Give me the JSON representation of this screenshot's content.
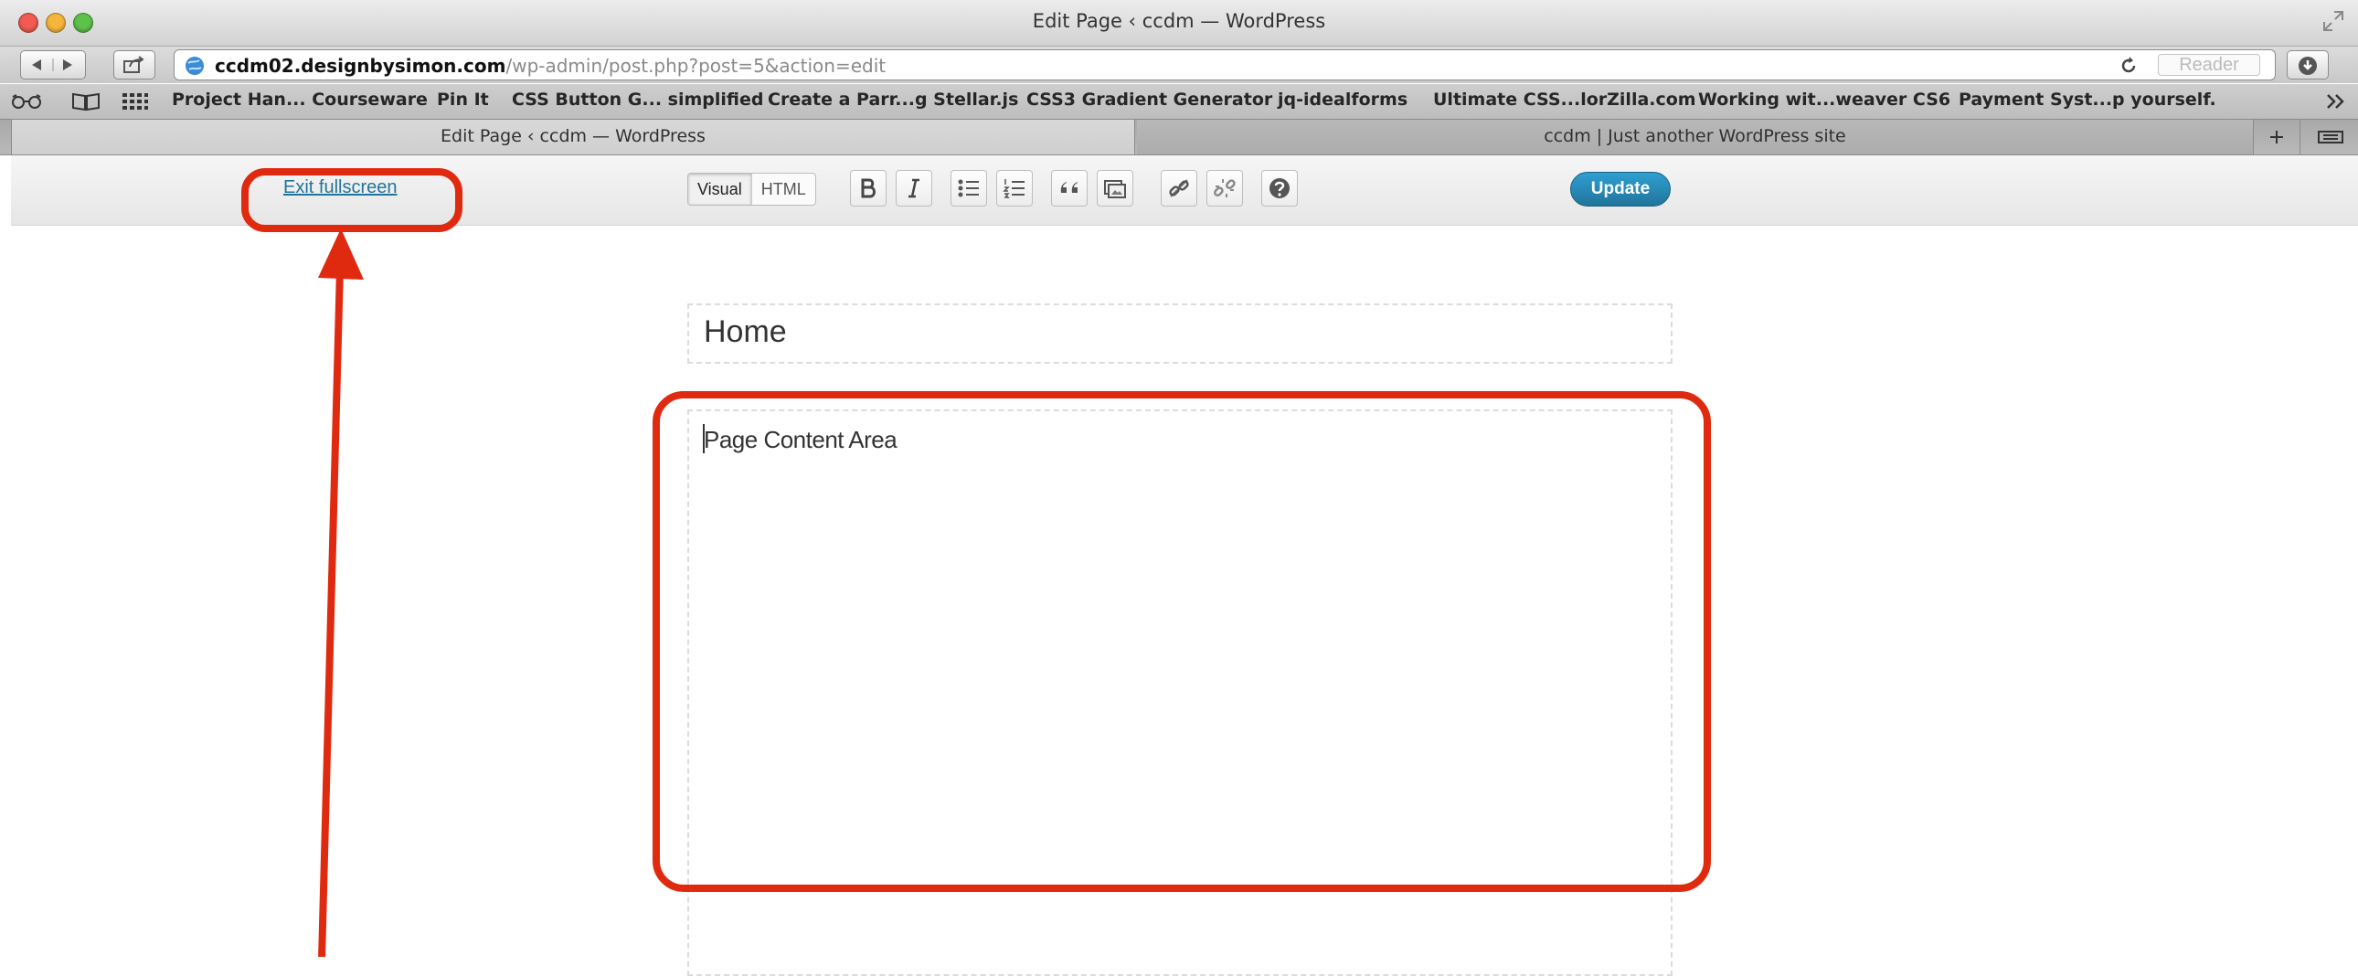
{
  "window": {
    "title": "Edit Page ‹ ccdm — WordPress"
  },
  "toolbar": {
    "url_host": "ccdm02.designbysimon.com",
    "url_path": "/wp-admin/post.php?post=5&action=edit",
    "reader_label": "Reader"
  },
  "bookmarks": [
    "Project Han... Courseware",
    "Pin It",
    "CSS Button G... simplified",
    "Create a Parr...g Stellar.js",
    "CSS3 Gradient Generator",
    "jq-idealforms",
    "Ultimate CSS...lorZilla.com",
    "Working wit...weaver CS6",
    "Payment Syst...p yourself."
  ],
  "tabs": [
    {
      "label": "Edit Page ‹ ccdm — WordPress",
      "active": true
    },
    {
      "label": "ccdm | Just another WordPress site",
      "active": false
    }
  ],
  "editor_toolbar": {
    "exit_label": "Exit fullscreen",
    "visual_label": "Visual",
    "html_label": "HTML",
    "update_label": "Update"
  },
  "editor": {
    "title": "Home",
    "content": "Page Content Area"
  },
  "colors": {
    "annotation": "#e02a10",
    "wp_link": "#21759b",
    "update_button": "#21759b"
  }
}
